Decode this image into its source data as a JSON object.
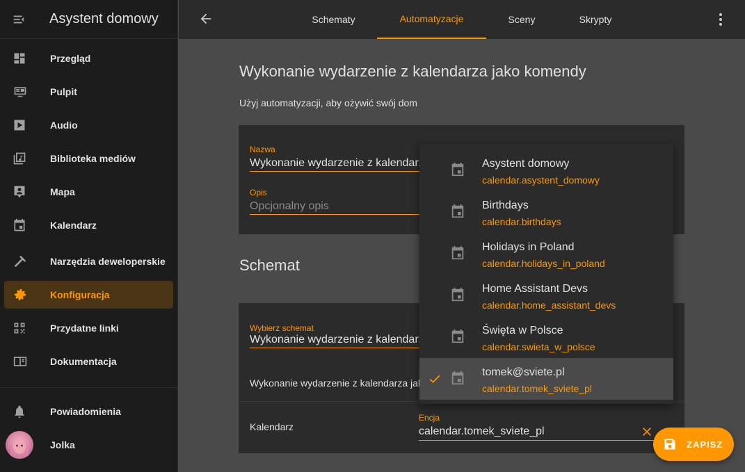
{
  "app": {
    "title": "Asystent domowy"
  },
  "sidebar": {
    "items": [
      {
        "label": "Przegląd",
        "icon": "dashboard-icon"
      },
      {
        "label": "Pulpit",
        "icon": "monitor-icon"
      },
      {
        "label": "Audio",
        "icon": "play-icon"
      },
      {
        "label": "Biblioteka mediów",
        "icon": "media-library-icon"
      },
      {
        "label": "Mapa",
        "icon": "map-person-icon"
      },
      {
        "label": "Kalendarz",
        "icon": "calendar-icon"
      },
      {
        "label": "Narzędzia deweloperskie",
        "icon": "hammer-icon"
      },
      {
        "label": "Konfiguracja",
        "icon": "gear-icon",
        "active": true
      },
      {
        "label": "Przydatne linki",
        "icon": "qrcode-icon"
      },
      {
        "label": "Dokumentacja",
        "icon": "book-icon"
      }
    ],
    "bottom": [
      {
        "label": "Powiadomienia",
        "icon": "bell-icon"
      },
      {
        "label": "Jolka",
        "icon": "avatar"
      }
    ]
  },
  "topbar": {
    "tabs": [
      {
        "label": "Schematy"
      },
      {
        "label": "Automatyzacje",
        "active": true
      },
      {
        "label": "Sceny"
      },
      {
        "label": "Skrypty"
      }
    ]
  },
  "main": {
    "title": "Wykonanie wydarzenie z kalendarza jako komendy",
    "intro": "Użyj automatyzacji, aby ożywić swój dom",
    "name_label": "Nazwa",
    "name_value": "Wykonanie wydarzenie z kalendarza",
    "desc_label": "Opis",
    "desc_placeholder": "Opcjonalny opis",
    "schema_heading": "Schemat",
    "schema_label": "Wybierz schemat",
    "schema_value": "Wykonanie wydarzenie z kalendarza",
    "schema_desc": "Wykonanie wydarzenie z kalendarza jak",
    "calendar_label": "Kalendarz",
    "entity_label": "Encja",
    "entity_value": "calendar.tomek_sviete_pl"
  },
  "dropdown": {
    "items": [
      {
        "title": "Asystent domowy",
        "entity": "calendar.asystent_domowy"
      },
      {
        "title": "Birthdays",
        "entity": "calendar.birthdays"
      },
      {
        "title": "Holidays in Poland",
        "entity": "calendar.holidays_in_poland"
      },
      {
        "title": "Home Assistant Devs",
        "entity": "calendar.home_assistant_devs"
      },
      {
        "title": "Święta w Polsce",
        "entity": "calendar.swieta_w_polsce"
      },
      {
        "title": "tomek@sviete.pl",
        "entity": "calendar.tomek_sviete_pl",
        "selected": true
      }
    ]
  },
  "fab": {
    "label": "ZAPISZ"
  },
  "colors": {
    "accent": "#ff9800",
    "sidebar_bg": "#1c1c1c",
    "card_bg": "#2b2b2b",
    "content_bg": "#4a4a4a"
  }
}
